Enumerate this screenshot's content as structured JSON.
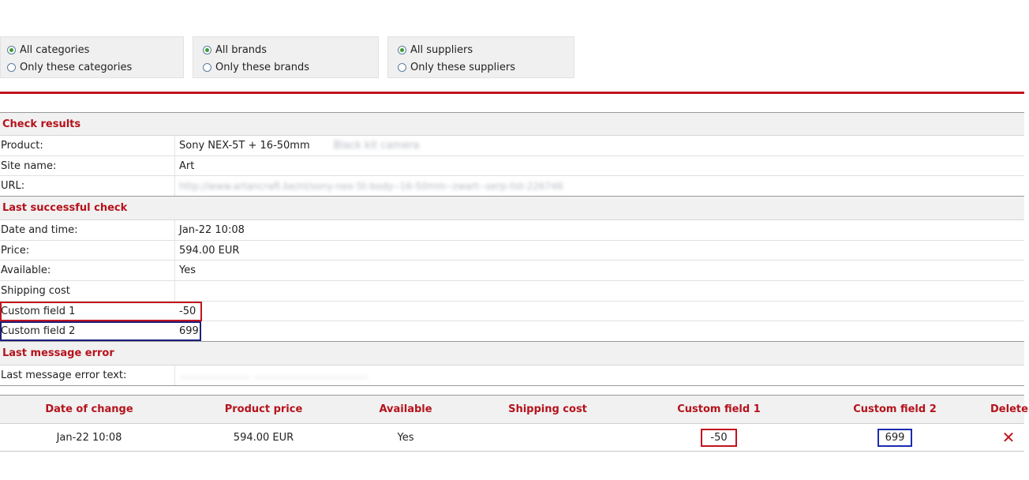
{
  "filters": {
    "categories": {
      "all_label": "All categories",
      "only_label": "Only these categories",
      "selected": "all"
    },
    "brands": {
      "all_label": "All brands",
      "only_label": "Only these brands",
      "selected": "all"
    },
    "suppliers": {
      "all_label": "All suppliers",
      "only_label": "Only these suppliers",
      "selected": "all"
    }
  },
  "check_results": {
    "heading": "Check results",
    "product_label": "Product:",
    "product_value": "Sony NEX-5T + 16-50mm",
    "product_value_blurred": "Black kit camera",
    "site_label": "Site name:",
    "site_value": "Art",
    "url_label": "URL:",
    "url_value": "http://www.artancraft.be/nl/sony-nex-5t-body--16-50mm--zwart--serp-list-226746"
  },
  "last_success": {
    "heading": "Last successful check",
    "date_label": "Date and time:",
    "date_value": "Jan-22 10:08",
    "price_label": "Price:",
    "price_value": "594.00 EUR",
    "available_label": "Available:",
    "available_value": "Yes",
    "shipping_label": "Shipping cost",
    "shipping_value": "",
    "custom1_label": "Custom field 1",
    "custom1_value": "-50",
    "custom2_label": "Custom field 2",
    "custom2_value": "699"
  },
  "last_error": {
    "heading": "Last message error",
    "text_label": "Last message error text:",
    "text_value": "...................... ..................................."
  },
  "history": {
    "columns": [
      "Date of change",
      "Product price",
      "Available",
      "Shipping cost",
      "Custom field 1",
      "Custom field 2",
      "Delete"
    ],
    "rows": [
      {
        "date": "Jan-22 10:08",
        "price": "594.00 EUR",
        "available": "Yes",
        "shipping": "",
        "custom1": "-50",
        "custom2": "699"
      }
    ]
  },
  "colors": {
    "accent_red": "#c0141e",
    "header_red": "#b5121b",
    "highlight_blue": "#1d1f7a",
    "radio_green": "#3b9a34"
  },
  "icons": {
    "delete": "close-x-icon"
  }
}
